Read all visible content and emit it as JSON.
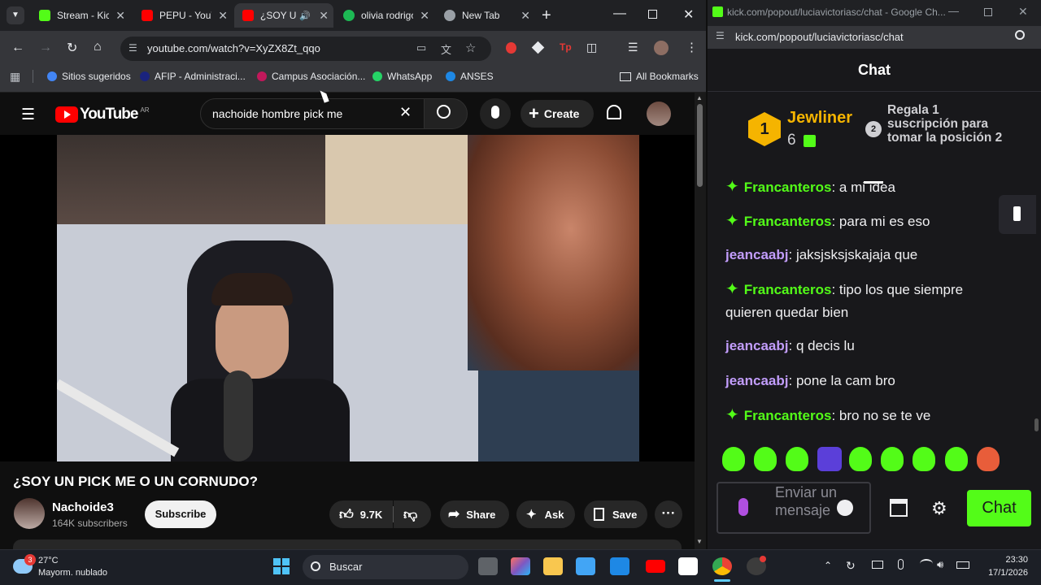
{
  "browser": {
    "tabs": [
      {
        "title": "Stream - Kick",
        "color": "#53fc18"
      },
      {
        "title": "PEPU - YouTube",
        "color": "#ff0000"
      },
      {
        "title": "¿SOY UN PICK ME",
        "color": "#ff0000"
      },
      {
        "title": "olivia rodrigo",
        "color": "#1db954"
      },
      {
        "title": "New Tab",
        "color": "#9aa0a6"
      }
    ],
    "new_tab": "+",
    "url": "youtube.com/watch?v=XyZX8Zt_qqo",
    "bookmarks": [
      {
        "label": "Sitios sugeridos",
        "color": "#4285f4"
      },
      {
        "label": "AFIP - Administraci...",
        "color": "#1a237e"
      },
      {
        "label": "Campus Asociación...",
        "color": "#c2185b"
      },
      {
        "label": "WhatsApp",
        "color": "#25d366"
      },
      {
        "label": "ANSES",
        "color": "#1e88e5"
      }
    ],
    "all_bookmarks": "All Bookmarks"
  },
  "youtube": {
    "logo": "YouTube",
    "region": "AR",
    "search_value": "nachoide hombre pick me",
    "create": "Create",
    "video_title": "¿SOY UN PICK ME O UN CORNUDO?",
    "channel": "Nachoide3",
    "subscribers": "164K subscribers",
    "subscribe": "Subscribe",
    "likes": "9.7K",
    "share": "Share",
    "ask": "Ask",
    "save": "Save"
  },
  "kick": {
    "window_title": "kick.com/popout/luciavictoriasc/chat - Google Ch...",
    "url": "kick.com/popout/luciavictoriasc/chat",
    "header": "Chat",
    "top_gifter": {
      "rank": "1",
      "name": "Jewliner",
      "count": "6"
    },
    "next_rank": "2",
    "gift_prompt": "Regala 1 suscripción para tomar la posición 2",
    "messages": [
      {
        "user": "Francanteros",
        "text": "a mi idea",
        "badge": true,
        "color": "#53fc18"
      },
      {
        "user": "Francanteros",
        "text": "para mi es eso",
        "badge": true,
        "color": "#53fc18"
      },
      {
        "user": "jeancaabj",
        "text": "jaksjsksjskajaja que",
        "badge": false,
        "color": "#c29dfc"
      },
      {
        "user": "Francanteros",
        "text": "tipo los que siempre quieren quedar bien",
        "badge": true,
        "color": "#53fc18"
      },
      {
        "user": "jeancaabj",
        "text": "q decis lu",
        "badge": false,
        "color": "#c29dfc"
      },
      {
        "user": "jeancaabj",
        "text": "pone la cam bro",
        "badge": false,
        "color": "#c29dfc"
      },
      {
        "user": "Francanteros",
        "text": "bro no se te ve",
        "badge": true,
        "color": "#53fc18"
      }
    ],
    "input_placeholder": "Enviar un mensaje",
    "send": "Chat",
    "accent": "#53fc18"
  },
  "taskbar": {
    "temp": "27°C",
    "weather": "Mayorm. nublado",
    "weather_badge": "3",
    "search": "Buscar",
    "time": "23:30",
    "date": "17/1/2026"
  }
}
